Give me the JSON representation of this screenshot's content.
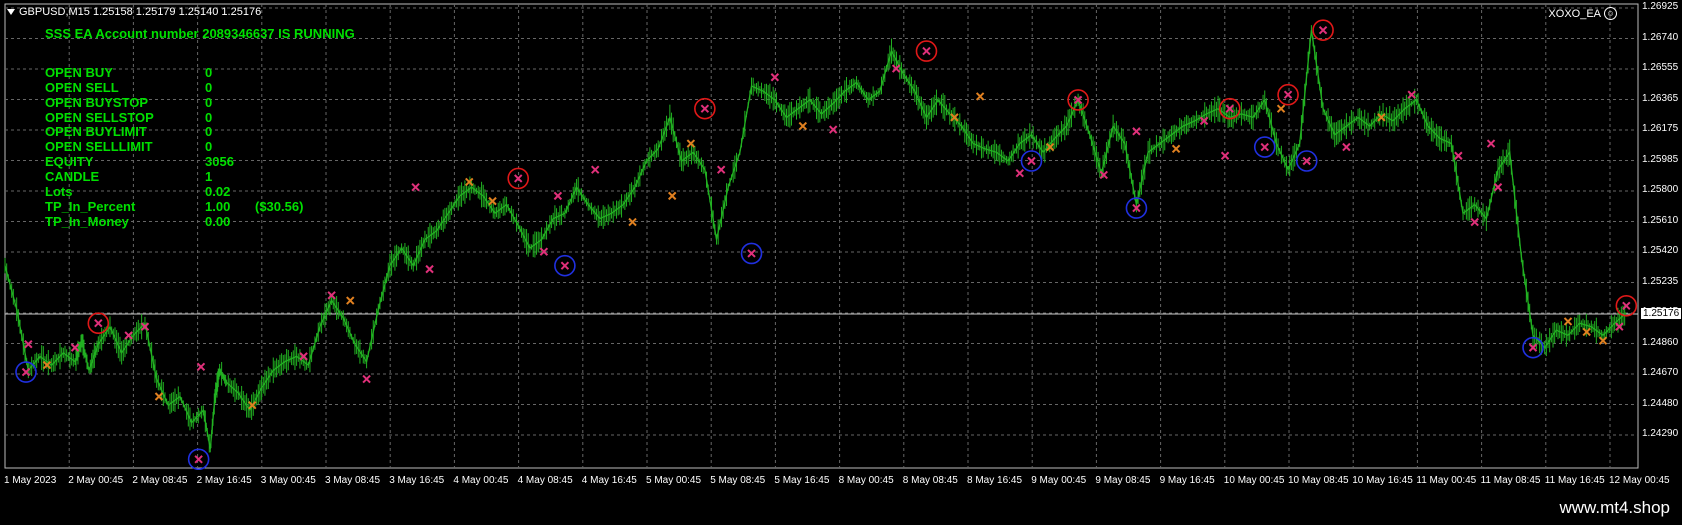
{
  "header": {
    "symbol_info": "GBPUSD,M15 1.25158 1.25179 1.25140 1.25176"
  },
  "ea": {
    "name": "XOXO_EA"
  },
  "panel": {
    "running": "SSS EA Account number 2089346637 IS RUNNING",
    "rows": [
      {
        "label": "OPEN BUY",
        "value": "0",
        "extra": ""
      },
      {
        "label": "OPEN SELL",
        "value": "0",
        "extra": ""
      },
      {
        "label": "OPEN BUYSTOP",
        "value": "0",
        "extra": ""
      },
      {
        "label": "OPEN SELLSTOP",
        "value": "0",
        "extra": ""
      },
      {
        "label": "OPEN BUYLIMIT",
        "value": "0",
        "extra": ""
      },
      {
        "label": "OPEN SELLLIMIT",
        "value": "0",
        "extra": ""
      },
      {
        "label": "EQUITY",
        "value": "3056",
        "extra": ""
      },
      {
        "label": "CANDLE",
        "value": "1",
        "extra": ""
      },
      {
        "label": "Lots",
        "value": "0.02",
        "extra": ""
      },
      {
        "label": "TP_In_Percent",
        "value": "1.00",
        "extra": "($30.56)"
      },
      {
        "label": "TP_In_Money",
        "value": "0.00",
        "extra": ""
      }
    ]
  },
  "y_axis": [
    "1.26925",
    "1.26740",
    "1.26555",
    "1.26365",
    "1.26175",
    "1.25985",
    "1.25800",
    "1.25610",
    "1.25420",
    "1.25235",
    "1.25045",
    "1.24860",
    "1.24670",
    "1.24480",
    "1.24290"
  ],
  "current_price": "1.25176",
  "x_axis": [
    "1 May 2023",
    "2 May 00:45",
    "2 May 08:45",
    "2 May 16:45",
    "3 May 00:45",
    "3 May 08:45",
    "3 May 16:45",
    "4 May 00:45",
    "4 May 08:45",
    "4 May 16:45",
    "5 May 00:45",
    "5 May 08:45",
    "5 May 16:45",
    "8 May 00:45",
    "8 May 08:45",
    "8 May 16:45",
    "9 May 00:45",
    "9 May 08:45",
    "9 May 16:45",
    "10 May 00:45",
    "10 May 08:45",
    "10 May 16:45",
    "11 May 00:45",
    "11 May 08:45",
    "11 May 16:45",
    "12 May 00:45"
  ],
  "chart_data": {
    "type": "line",
    "symbol": "GBPUSD",
    "timeframe": "M15",
    "ylim": [
      1.2429,
      1.2695
    ],
    "grid": true,
    "price_path": [
      [
        0,
        1.2545
      ],
      [
        0.5,
        1.252
      ],
      [
        1,
        1.2485
      ],
      [
        1.5,
        1.2493
      ],
      [
        2,
        1.2488
      ],
      [
        2.5,
        1.2495
      ],
      [
        3,
        1.249
      ],
      [
        3.3,
        1.2502
      ],
      [
        3.6,
        1.2485
      ],
      [
        4,
        1.25
      ],
      [
        4.5,
        1.251
      ],
      [
        5,
        1.2495
      ],
      [
        5.5,
        1.2505
      ],
      [
        6,
        1.2512
      ],
      [
        6.5,
        1.248
      ],
      [
        7,
        1.2465
      ],
      [
        7.5,
        1.247
      ],
      [
        8,
        1.2455
      ],
      [
        8.5,
        1.2462
      ],
      [
        8.8,
        1.244
      ],
      [
        9,
        1.247
      ],
      [
        9.2,
        1.2485
      ],
      [
        9.5,
        1.2478
      ],
      [
        10,
        1.2472
      ],
      [
        10.5,
        1.2462
      ],
      [
        11,
        1.2475
      ],
      [
        11.5,
        1.2485
      ],
      [
        12,
        1.249
      ],
      [
        12.5,
        1.2493
      ],
      [
        13,
        1.2488
      ],
      [
        13.5,
        1.251
      ],
      [
        14,
        1.2525
      ],
      [
        14.5,
        1.2515
      ],
      [
        15,
        1.25
      ],
      [
        15.5,
        1.249
      ],
      [
        16,
        1.252
      ],
      [
        16.5,
        1.2545
      ],
      [
        17,
        1.2555
      ],
      [
        17.5,
        1.2545
      ],
      [
        18,
        1.256
      ],
      [
        18.5,
        1.2565
      ],
      [
        19,
        1.2575
      ],
      [
        19.5,
        1.2585
      ],
      [
        20,
        1.259
      ],
      [
        20.5,
        1.2585
      ],
      [
        21,
        1.2575
      ],
      [
        21.5,
        1.258
      ],
      [
        22,
        1.2568
      ],
      [
        22.5,
        1.2555
      ],
      [
        23,
        1.256
      ],
      [
        23.5,
        1.2572
      ],
      [
        24,
        1.2575
      ],
      [
        24.5,
        1.259
      ],
      [
        25,
        1.258
      ],
      [
        25.5,
        1.2572
      ],
      [
        26,
        1.2575
      ],
      [
        26.5,
        1.258
      ],
      [
        27,
        1.259
      ],
      [
        27.5,
        1.2605
      ],
      [
        28,
        1.2612
      ],
      [
        28.5,
        1.263
      ],
      [
        29,
        1.2605
      ],
      [
        29.5,
        1.261
      ],
      [
        30,
        1.26
      ],
      [
        30.5,
        1.256
      ],
      [
        31,
        1.259
      ],
      [
        31.5,
        1.261
      ],
      [
        32,
        1.2648
      ],
      [
        32.5,
        1.2645
      ],
      [
        33,
        1.264
      ],
      [
        33.5,
        1.263
      ],
      [
        34,
        1.2635
      ],
      [
        34.5,
        1.264
      ],
      [
        35,
        1.2632
      ],
      [
        35.5,
        1.2638
      ],
      [
        36,
        1.2645
      ],
      [
        36.5,
        1.265
      ],
      [
        37,
        1.264
      ],
      [
        37.5,
        1.2645
      ],
      [
        38,
        1.2668
      ],
      [
        38.5,
        1.2655
      ],
      [
        39,
        1.2645
      ],
      [
        39.5,
        1.263
      ],
      [
        40,
        1.264
      ],
      [
        40.5,
        1.2632
      ],
      [
        41,
        1.2625
      ],
      [
        41.5,
        1.2615
      ],
      [
        42,
        1.2612
      ],
      [
        42.5,
        1.261
      ],
      [
        43,
        1.2605
      ],
      [
        43.5,
        1.2615
      ],
      [
        44,
        1.262
      ],
      [
        44.5,
        1.261
      ],
      [
        45,
        1.2618
      ],
      [
        45.5,
        1.2625
      ],
      [
        46,
        1.264
      ],
      [
        46.5,
        1.262
      ],
      [
        47,
        1.2598
      ],
      [
        47.5,
        1.2625
      ],
      [
        48,
        1.2615
      ],
      [
        48.5,
        1.258
      ],
      [
        49,
        1.261
      ],
      [
        49.5,
        1.2615
      ],
      [
        50,
        1.262
      ],
      [
        50.5,
        1.2625
      ],
      [
        51,
        1.2628
      ],
      [
        51.5,
        1.2632
      ],
      [
        52,
        1.2635
      ],
      [
        52.5,
        1.263
      ],
      [
        53,
        1.2632
      ],
      [
        53.5,
        1.263
      ],
      [
        54,
        1.264
      ],
      [
        54.5,
        1.2615
      ],
      [
        55,
        1.26
      ],
      [
        55.5,
        1.2615
      ],
      [
        56,
        1.268
      ],
      [
        56.5,
        1.2635
      ],
      [
        57,
        1.262
      ],
      [
        57.5,
        1.2625
      ],
      [
        58,
        1.263
      ],
      [
        58.5,
        1.2625
      ],
      [
        59,
        1.2632
      ],
      [
        59.5,
        1.2628
      ],
      [
        60,
        1.2635
      ],
      [
        60.5,
        1.264
      ],
      [
        61,
        1.2625
      ],
      [
        61.5,
        1.2618
      ],
      [
        62,
        1.2615
      ],
      [
        62.5,
        1.2575
      ],
      [
        63,
        1.258
      ],
      [
        63.5,
        1.2572
      ],
      [
        64,
        1.26
      ],
      [
        64.5,
        1.261
      ],
      [
        65,
        1.255
      ],
      [
        65.5,
        1.2505
      ],
      [
        66,
        1.2498
      ],
      [
        66.5,
        1.2508
      ],
      [
        67,
        1.2505
      ],
      [
        67.5,
        1.2512
      ],
      [
        68,
        1.251
      ],
      [
        68.5,
        1.2505
      ],
      [
        69,
        1.2512
      ],
      [
        69.5,
        1.2518
      ]
    ],
    "red_circle_markers": [
      [
        4,
        1.2512
      ],
      [
        22,
        1.2595
      ],
      [
        30,
        1.2635
      ],
      [
        39.5,
        1.2668
      ],
      [
        46,
        1.264
      ],
      [
        52.5,
        1.2635
      ],
      [
        55,
        1.2643
      ],
      [
        56.5,
        1.268
      ],
      [
        69.5,
        1.2522
      ]
    ],
    "blue_circle_markers": [
      [
        0.9,
        1.2484
      ],
      [
        8.3,
        1.2434
      ],
      [
        24,
        1.2545
      ],
      [
        32,
        1.2552
      ],
      [
        44,
        1.2605
      ],
      [
        48.5,
        1.2578
      ],
      [
        54,
        1.2613
      ],
      [
        55.8,
        1.2605
      ],
      [
        65.5,
        1.2498
      ]
    ],
    "x_markers": [
      {
        "x": 1.0,
        "y": 1.25,
        "color": "#e0307a"
      },
      {
        "x": 1.8,
        "y": 1.2488,
        "color": "#e08020"
      },
      {
        "x": 3.0,
        "y": 1.2498,
        "color": "#e0307a"
      },
      {
        "x": 5.3,
        "y": 1.2505,
        "color": "#e0307a"
      },
      {
        "x": 6.0,
        "y": 1.251,
        "color": "#e0307a"
      },
      {
        "x": 6.6,
        "y": 1.247,
        "color": "#e08020"
      },
      {
        "x": 8.4,
        "y": 1.2487,
        "color": "#e0307a"
      },
      {
        "x": 10.6,
        "y": 1.2465,
        "color": "#e08020"
      },
      {
        "x": 12.8,
        "y": 1.2493,
        "color": "#e0307a"
      },
      {
        "x": 14.0,
        "y": 1.2528,
        "color": "#e0307a"
      },
      {
        "x": 14.8,
        "y": 1.2525,
        "color": "#e08020"
      },
      {
        "x": 15.5,
        "y": 1.248,
        "color": "#e0307a"
      },
      {
        "x": 17.6,
        "y": 1.259,
        "color": "#e0307a"
      },
      {
        "x": 18.2,
        "y": 1.2543,
        "color": "#e0307a"
      },
      {
        "x": 19.9,
        "y": 1.2593,
        "color": "#e08020"
      },
      {
        "x": 20.9,
        "y": 1.2582,
        "color": "#e08020"
      },
      {
        "x": 23.1,
        "y": 1.2553,
        "color": "#e0307a"
      },
      {
        "x": 23.7,
        "y": 1.2585,
        "color": "#e0307a"
      },
      {
        "x": 25.3,
        "y": 1.26,
        "color": "#e0307a"
      },
      {
        "x": 26.9,
        "y": 1.257,
        "color": "#e08020"
      },
      {
        "x": 28.6,
        "y": 1.2585,
        "color": "#e08020"
      },
      {
        "x": 29.4,
        "y": 1.2615,
        "color": "#e08020"
      },
      {
        "x": 30.7,
        "y": 1.26,
        "color": "#e0307a"
      },
      {
        "x": 33.0,
        "y": 1.2653,
        "color": "#e0307a"
      },
      {
        "x": 34.2,
        "y": 1.2625,
        "color": "#e08020"
      },
      {
        "x": 35.5,
        "y": 1.2623,
        "color": "#e0307a"
      },
      {
        "x": 38.2,
        "y": 1.2658,
        "color": "#e0307a"
      },
      {
        "x": 40.7,
        "y": 1.263,
        "color": "#e08020"
      },
      {
        "x": 41.8,
        "y": 1.2642,
        "color": "#e08020"
      },
      {
        "x": 43.5,
        "y": 1.2598,
        "color": "#e0307a"
      },
      {
        "x": 44.8,
        "y": 1.2613,
        "color": "#e08020"
      },
      {
        "x": 47.1,
        "y": 1.2597,
        "color": "#e0307a"
      },
      {
        "x": 48.5,
        "y": 1.2622,
        "color": "#e0307a"
      },
      {
        "x": 50.2,
        "y": 1.2612,
        "color": "#e08020"
      },
      {
        "x": 51.4,
        "y": 1.2628,
        "color": "#e0307a"
      },
      {
        "x": 52.3,
        "y": 1.2608,
        "color": "#e0307a"
      },
      {
        "x": 54.7,
        "y": 1.2635,
        "color": "#e08020"
      },
      {
        "x": 57.5,
        "y": 1.2613,
        "color": "#e0307a"
      },
      {
        "x": 59.0,
        "y": 1.263,
        "color": "#e08020"
      },
      {
        "x": 60.3,
        "y": 1.2643,
        "color": "#e0307a"
      },
      {
        "x": 62.3,
        "y": 1.2608,
        "color": "#e0307a"
      },
      {
        "x": 63.0,
        "y": 1.257,
        "color": "#e0307a"
      },
      {
        "x": 63.7,
        "y": 1.2615,
        "color": "#e0307a"
      },
      {
        "x": 64.0,
        "y": 1.259,
        "color": "#e0307a"
      },
      {
        "x": 67.0,
        "y": 1.2513,
        "color": "#e08020"
      },
      {
        "x": 67.8,
        "y": 1.2507,
        "color": "#e08020"
      },
      {
        "x": 68.5,
        "y": 1.2502,
        "color": "#e08020"
      },
      {
        "x": 69.2,
        "y": 1.251,
        "color": "#e0307a"
      }
    ],
    "colors": {
      "price": "#22b222",
      "grid": "#666666",
      "red_marker": "#e01818",
      "blue_marker": "#2030e0"
    }
  },
  "watermark": "www.mt4.shop"
}
